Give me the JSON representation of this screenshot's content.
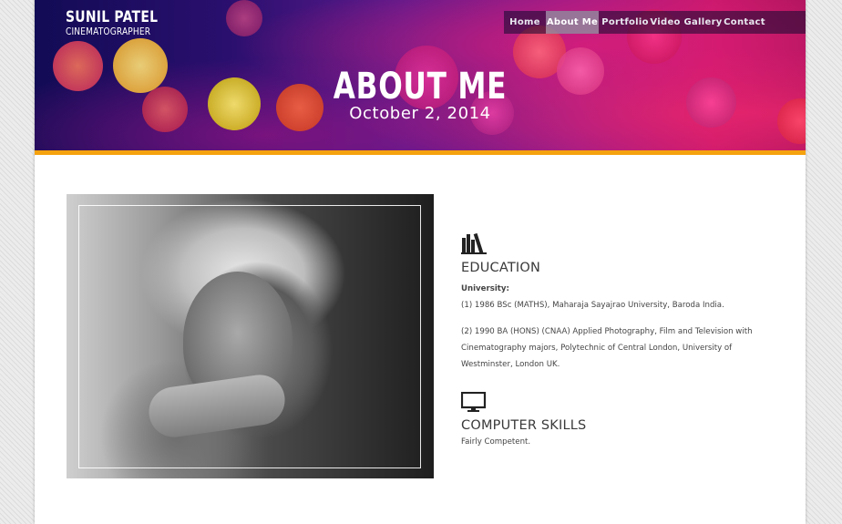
{
  "site": {
    "name": "SUNIL PATEL",
    "tagline": "CINEMATOGRAPHER"
  },
  "nav": {
    "items": [
      {
        "label": "Home",
        "active": false
      },
      {
        "label": "About Me",
        "active": true
      },
      {
        "label": "Portfolio",
        "active": false
      },
      {
        "label": "Video Gallery",
        "active": false
      },
      {
        "label": "Contact",
        "active": false
      }
    ]
  },
  "hero": {
    "title": "ABOUT ME",
    "date": "October 2, 2014"
  },
  "education": {
    "icon": "books-icon",
    "heading": "EDUCATION",
    "university_label": "University:",
    "entry1": "(1) 1986 BSc (MATHS), Maharaja Sayajrao University, Baroda India.",
    "entry2_lines": [
      "(2) 1990 BA (HONS) (CNAA) Applied Photography, Film and Television with",
      "Cinematography majors, Polytechnic of Central London, University of",
      "Westminster, London UK."
    ]
  },
  "skills": {
    "icon": "monitor-icon",
    "heading": "COMPUTER SKILLS",
    "text": "Fairly Competent."
  },
  "colors": {
    "accent_stripe": "#f5a20f",
    "nav_active_bg": "#c8c8d2"
  }
}
